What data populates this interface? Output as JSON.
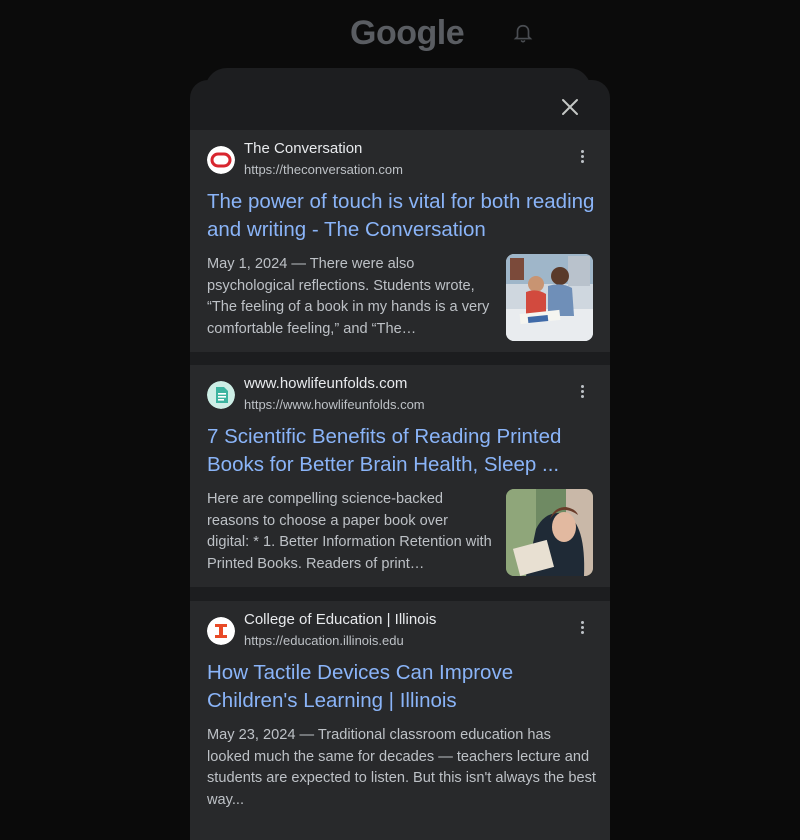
{
  "header": {
    "logo": "Google",
    "bell_icon": "bell-icon"
  },
  "sheet": {
    "close_icon": "close-icon"
  },
  "results": [
    {
      "site_name": "The Conversation",
      "url": "https://theconversation.com",
      "title": "The power of touch is vital for both reading and writing - The Conversation",
      "snippet": "May 1, 2024 — There were also psychological reflections. Students wrote, “The feeling of a book in my hands is a very comfortable feeling,” and “The…",
      "favicon": "the-conversation-logo",
      "thumbnail": "children-reading-photo"
    },
    {
      "site_name": "www.howlifeunfolds.com",
      "url": "https://www.howlifeunfolds.com",
      "title": "7 Scientific Benefits of Reading Printed Books for Better Brain Health, Sleep ...",
      "snippet": "Here are compelling science-backed reasons to choose a paper book over digital: * 1. Better Information Retention with Printed Books. Readers of print…",
      "favicon": "document-icon",
      "thumbnail": "woman-reading-photo"
    },
    {
      "site_name": "College of Education | Illinois",
      "url": "https://education.illinois.edu",
      "title": "How Tactile Devices Can Improve Children's Learning | Illinois",
      "snippet": "May 23, 2024 — Traditional classroom education has looked much the same for decades — teachers lecture and students are expected to listen. But this isn't always the best way...",
      "favicon": "illinois-logo"
    }
  ],
  "colors": {
    "background": "#0a0a0a",
    "sheet": "#1c1d1f",
    "card": "#28292b",
    "title_link": "#8ab4f8",
    "text_primary": "#e8eaed",
    "text_secondary": "#bdc1c6",
    "illinois_orange": "#e84a27"
  }
}
